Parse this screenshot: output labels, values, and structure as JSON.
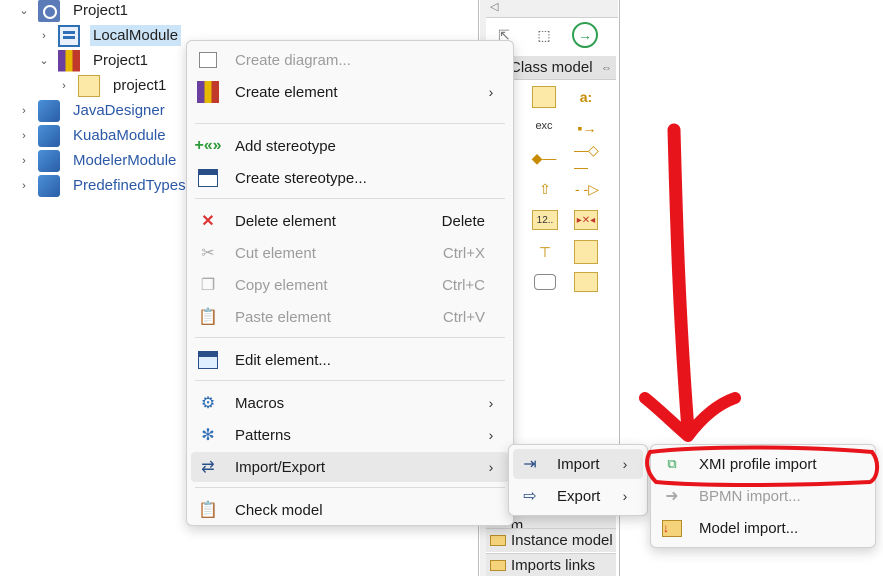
{
  "tree": {
    "items": [
      {
        "label": "Project1"
      },
      {
        "label": "LocalModule"
      },
      {
        "label": "Project1"
      },
      {
        "label": "project1"
      },
      {
        "label": "JavaDesigner"
      },
      {
        "label": "KuabaModule"
      },
      {
        "label": "ModelerModule"
      },
      {
        "label": "PredefinedTypes"
      }
    ]
  },
  "palette": {
    "class_model_label": "Class model",
    "exc_label": "exc",
    "field_label": "a:",
    "num_label": "12..",
    "categories": [
      {
        "label": "Component m..."
      },
      {
        "label": "Instance model"
      },
      {
        "label": "Imports links"
      }
    ]
  },
  "context_menu": {
    "items": [
      {
        "label": "Create diagram...",
        "shortcut": ""
      },
      {
        "label": "Create element",
        "shortcut": ""
      },
      {
        "label": "Add stereotype",
        "shortcut": ""
      },
      {
        "label": "Create stereotype...",
        "shortcut": ""
      },
      {
        "label": "Delete element",
        "shortcut": "Delete"
      },
      {
        "label": "Cut element",
        "shortcut": "Ctrl+X"
      },
      {
        "label": "Copy element",
        "shortcut": "Ctrl+C"
      },
      {
        "label": "Paste element",
        "shortcut": "Ctrl+V"
      },
      {
        "label": "Edit element...",
        "shortcut": ""
      },
      {
        "label": "Macros",
        "shortcut": ""
      },
      {
        "label": "Patterns",
        "shortcut": ""
      },
      {
        "label": "Import/Export",
        "shortcut": ""
      },
      {
        "label": "Check model",
        "shortcut": ""
      }
    ]
  },
  "import_export_submenu": {
    "items": [
      {
        "label": "Import"
      },
      {
        "label": "Export"
      }
    ]
  },
  "import_submenu": {
    "items": [
      {
        "label": "XMI profile import"
      },
      {
        "label": "BPMN import..."
      },
      {
        "label": "Model import..."
      }
    ]
  },
  "colors": {
    "annotation": "#e8141c",
    "selection": "#cce4f7",
    "link_blue": "#2b58a6"
  }
}
